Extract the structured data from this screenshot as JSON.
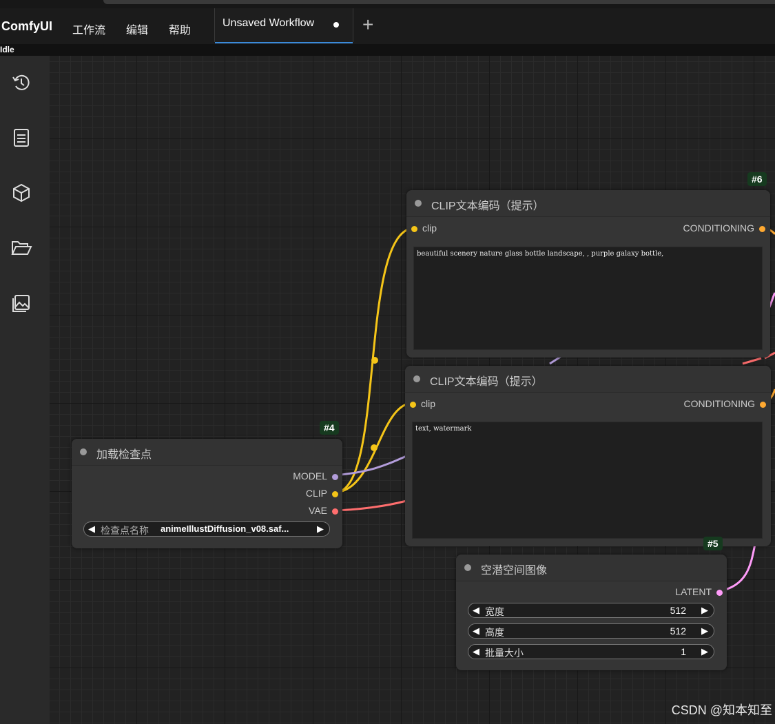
{
  "app": {
    "brand": "ComfyUI",
    "menu": [
      "工作流",
      "编辑",
      "帮助"
    ],
    "tab_label": "Unsaved Workflow",
    "add_tab": "+",
    "status": "Idle"
  },
  "sidebar": {
    "items": [
      {
        "icon": "history-icon"
      },
      {
        "icon": "queue-list-icon"
      },
      {
        "icon": "node-library-cube-icon"
      },
      {
        "icon": "workflows-folder-icon"
      },
      {
        "icon": "templates-image-icon"
      }
    ]
  },
  "nodes": {
    "clip_pos": {
      "id": "#6",
      "title": "CLIP文本编码（提示）",
      "input": "clip",
      "output": "CONDITIONING",
      "text": "beautiful scenery nature glass bottle landscape, , purple galaxy bottle,"
    },
    "clip_neg": {
      "title": "CLIP文本编码（提示）",
      "input": "clip",
      "output": "CONDITIONING",
      "text": "text, watermark"
    },
    "checkpoint": {
      "id": "#4",
      "title": "加载检查点",
      "outputs": [
        "MODEL",
        "CLIP",
        "VAE"
      ],
      "widget_name": "检查点名称",
      "widget_value": "animeIllustDiffusion_v08.saf..."
    },
    "latent": {
      "id": "#5",
      "title": "空潜空间图像",
      "output": "LATENT",
      "widgets": [
        {
          "name": "宽度",
          "value": "512"
        },
        {
          "name": "高度",
          "value": "512"
        },
        {
          "name": "批量大小",
          "value": "1"
        }
      ]
    }
  },
  "colors": {
    "clip": "#f5c518",
    "model": "#b39ddb",
    "vae": "#ff6e6e",
    "conditioning": "#ffa931",
    "latent": "#ff9cf9",
    "tab_accent": "#3b8ad9"
  },
  "watermark": "CSDN @知本知至"
}
